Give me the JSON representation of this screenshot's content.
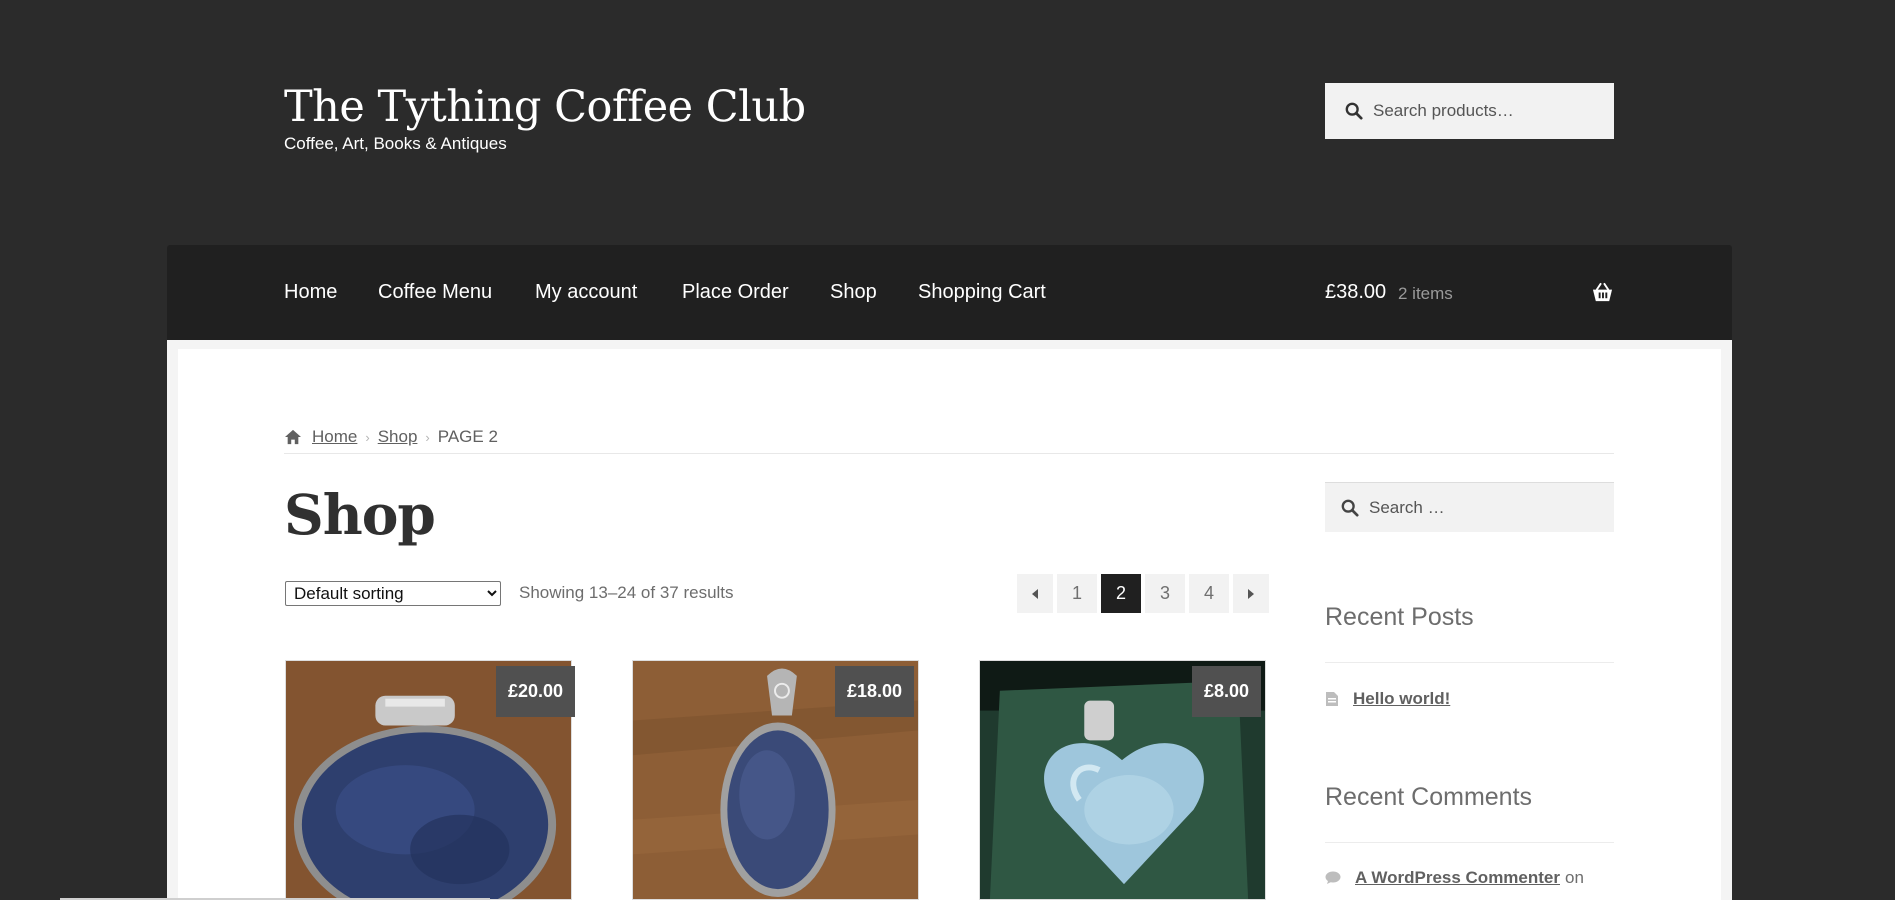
{
  "header": {
    "site_title": "The Tything Coffee Club",
    "site_description": "Coffee, Art, Books & Antiques",
    "search_placeholder": "Search products…"
  },
  "nav": {
    "items": [
      "Home",
      "Coffee Menu",
      "My account",
      "Place Order",
      "Shop",
      "Shopping Cart"
    ],
    "cart_amount": "£38.00",
    "cart_count": "2 items",
    "cart_icon": "basket-icon"
  },
  "breadcrumb": {
    "home": "Home",
    "shop": "Shop",
    "current": "PAGE 2"
  },
  "page": {
    "title": "Shop",
    "sort_selected": "Default sorting",
    "result_count": "Showing 13–24 of 37 results"
  },
  "pagination": {
    "prev_icon": "caret-left-icon",
    "pages": [
      "1",
      "2",
      "3",
      "4"
    ],
    "current": "2",
    "next_icon": "caret-right-icon"
  },
  "products": [
    {
      "price": "£20.00"
    },
    {
      "price": "£18.00"
    },
    {
      "price": "£8.00"
    }
  ],
  "sidebar": {
    "search_placeholder": "Search …",
    "recent_posts_title": "Recent Posts",
    "recent_posts": [
      "Hello world!"
    ],
    "recent_comments_title": "Recent Comments",
    "recent_comments": [
      {
        "author": "A WordPress Commenter",
        "on": "on"
      }
    ]
  },
  "colors": {
    "header_bg": "#2b2b2b",
    "nav_bg": "#202020",
    "price_badge": "#505050",
    "current_page": "#202020"
  }
}
